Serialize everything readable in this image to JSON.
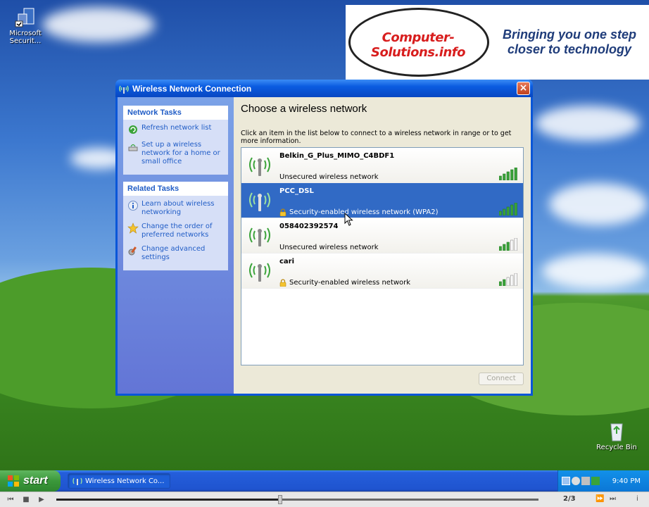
{
  "desktop": {
    "icons": [
      {
        "label_line1": "Microsoft",
        "label_line2": "Securit..."
      },
      {
        "label_line1": "Recycle Bin",
        "label_line2": ""
      }
    ]
  },
  "banner": {
    "logo_text": "Computer-Solutions.info",
    "tagline_line1": "Bringing you one step",
    "tagline_line2": "closer to technology"
  },
  "dialog": {
    "title": "Wireless Network Connection",
    "close_label": "×",
    "heading": "Choose a wireless network",
    "instructions": "Click an item in the list below to connect to a wireless network in range or to get more information.",
    "connect_label": "Connect"
  },
  "network_tasks": {
    "header": "Network Tasks",
    "items": [
      {
        "label": "Refresh network list",
        "icon": "refresh-icon"
      },
      {
        "label": "Set up a wireless network for a home or small office",
        "icon": "wireless-setup-icon"
      }
    ]
  },
  "related_tasks": {
    "header": "Related Tasks",
    "items": [
      {
        "label": "Learn about wireless networking",
        "icon": "info-icon"
      },
      {
        "label": "Change the order of preferred networks",
        "icon": "star-icon"
      },
      {
        "label": "Change advanced settings",
        "icon": "settings-icon"
      }
    ]
  },
  "networks": [
    {
      "ssid": "Belkin_G_Plus_MIMO_C4BDF1",
      "security": "Unsecured wireless network",
      "secured": false,
      "signal": 5,
      "selected": false
    },
    {
      "ssid": "PCC_DSL",
      "security": "Security-enabled wireless network (WPA2)",
      "secured": true,
      "signal": 5,
      "selected": true
    },
    {
      "ssid": "058402392574",
      "security": "Unsecured wireless network",
      "secured": false,
      "signal": 3,
      "selected": false
    },
    {
      "ssid": "cari",
      "security": "Security-enabled wireless network",
      "secured": true,
      "signal": 2,
      "selected": false
    }
  ],
  "taskbar": {
    "start_label": "start",
    "task_button": "Wireless Network Co...",
    "clock": "9:40 PM"
  },
  "player": {
    "page_counter": "2/3",
    "progress": 0.46
  },
  "colors": {
    "selected_row": "#316ac5",
    "task_link": "#215dc6",
    "signal_green": "#3aa33a"
  }
}
